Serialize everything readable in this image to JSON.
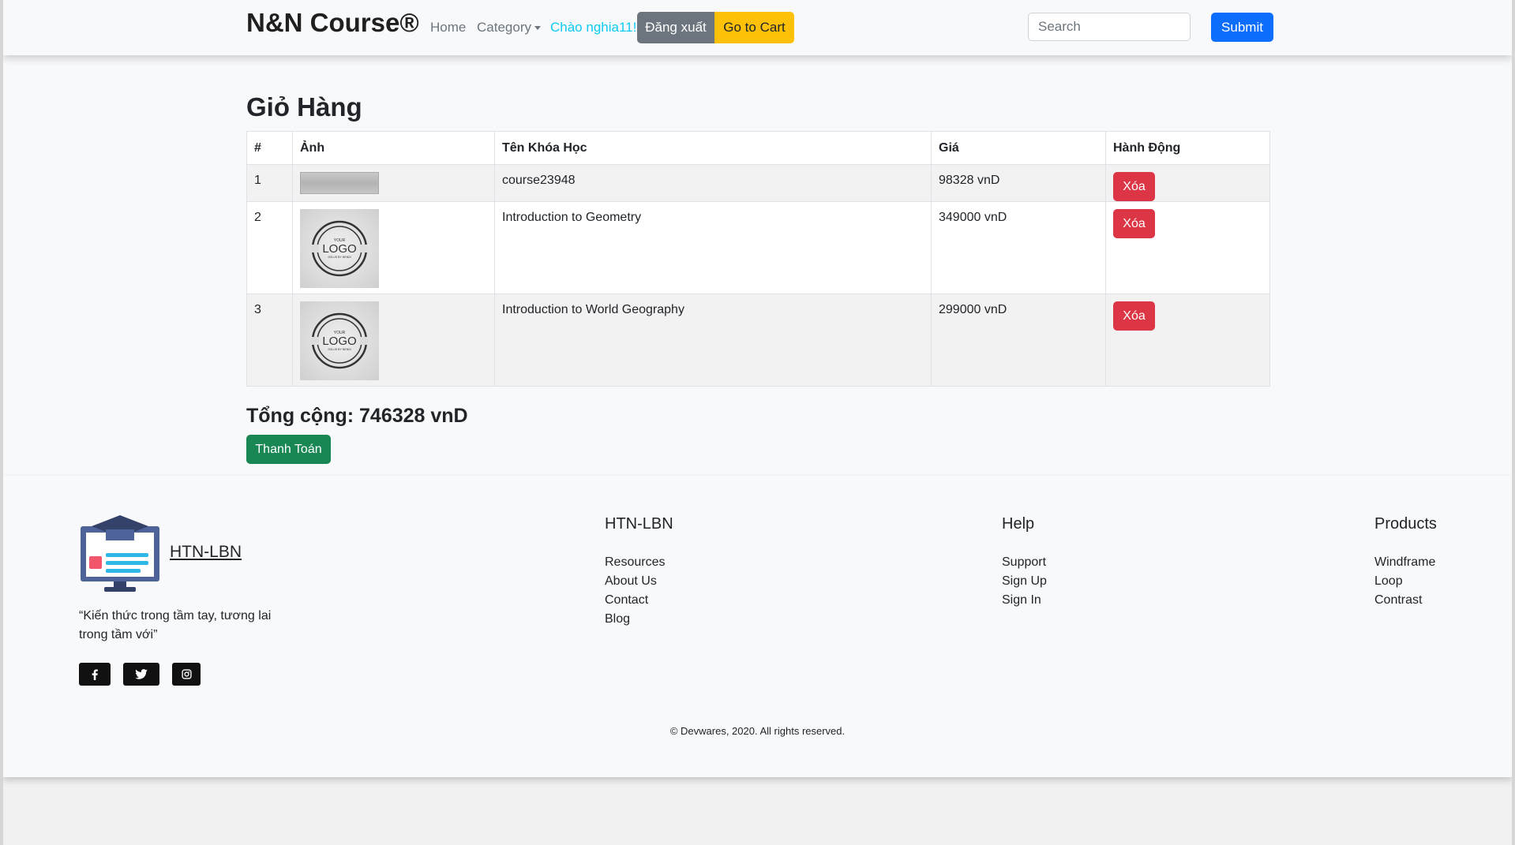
{
  "navbar": {
    "brand": "N&N Course®",
    "home": "Home",
    "category": "Category",
    "greeting": "Chào nghia11!",
    "logout": "Đăng xuất",
    "cart": "Go to Cart",
    "search_placeholder": "Search",
    "submit": "Submit"
  },
  "cart": {
    "title": "Giỏ Hàng",
    "headers": [
      "#",
      "Ảnh",
      "Tên Khóa Học",
      "Giá",
      "Hành Động"
    ],
    "rows": [
      {
        "index": "1",
        "name": "course23948",
        "price": "98328 vnD",
        "action": "Xóa"
      },
      {
        "index": "2",
        "name": "Introduction to Geometry",
        "price": "349000 vnD",
        "action": "Xóa"
      },
      {
        "index": "3",
        "name": "Introduction to World Geography",
        "price": "299000 vnD",
        "action": "Xóa"
      }
    ],
    "logo_text": {
      "top": "YOUR",
      "main": "LOGO",
      "bottom": "SOLUS BY NENDI"
    },
    "total": "Tổng cộng: 746328 vnD",
    "pay": "Thanh Toán"
  },
  "footer": {
    "brand": "HTN-LBN",
    "quote": "“Kiến thức trong tầm tay, tương lai trong tầm với”",
    "social": [
      "facebook-icon",
      "twitter-icon",
      "instagram-icon"
    ],
    "columns": [
      {
        "title": "HTN-LBN",
        "links": [
          "Resources",
          "About Us",
          "Contact",
          "Blog"
        ]
      },
      {
        "title": "Help",
        "links": [
          "Support",
          "Sign Up",
          "Sign In"
        ]
      },
      {
        "title": "Products",
        "links": [
          "Windframe",
          "Loop",
          "Contrast"
        ]
      }
    ],
    "copyright": "© Devwares, 2020. All rights reserved."
  },
  "colors": {
    "primary": "#0d6efd",
    "danger": "#dc3545",
    "success": "#198754",
    "warning": "#ffc107",
    "secondary": "#6c757d",
    "info": "#0dcaf0"
  }
}
